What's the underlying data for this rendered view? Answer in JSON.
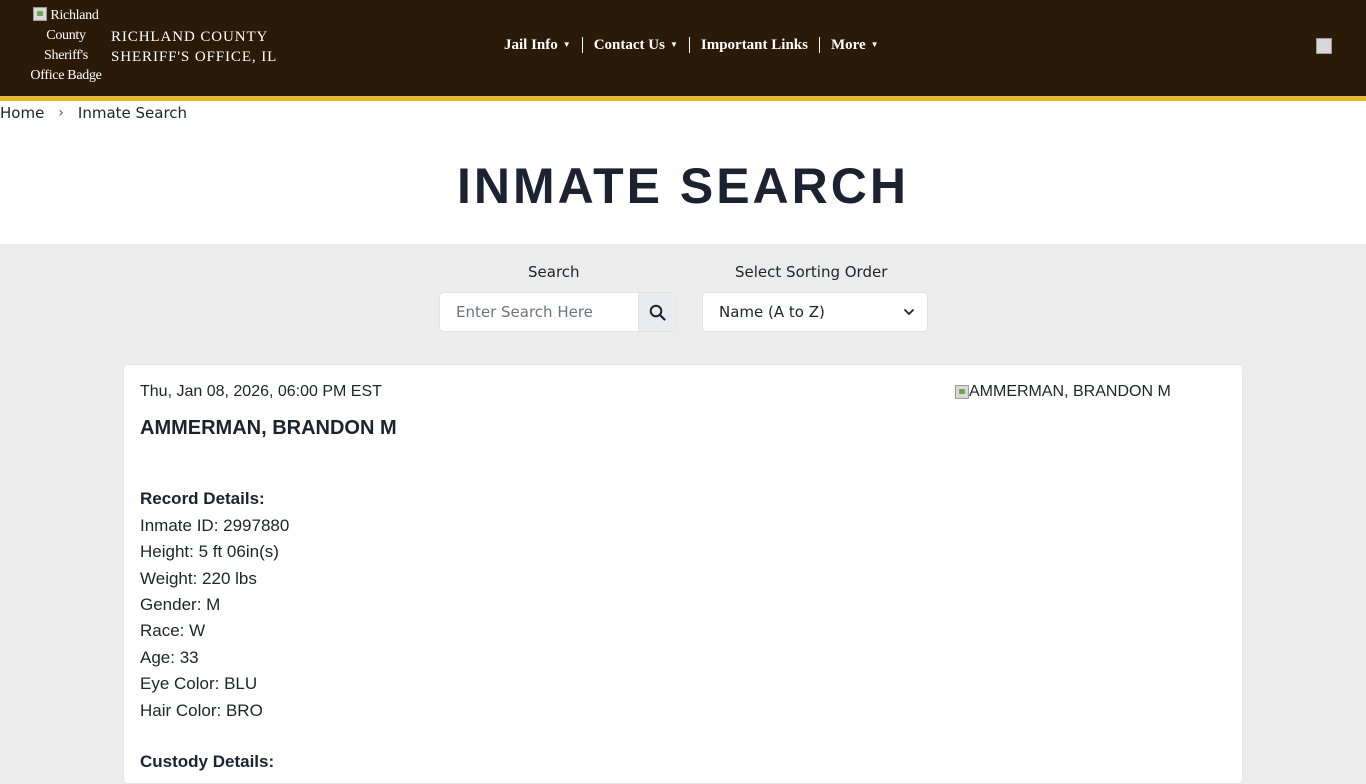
{
  "header": {
    "logo_alt": "Richland County Sheriff's Office Badge",
    "site_name_line1": "RICHLAND COUNTY",
    "site_name_line2": "SHERIFF'S OFFICE, IL",
    "nav": [
      {
        "label": "Jail Info",
        "has_dropdown": true
      },
      {
        "label": "Contact Us",
        "has_dropdown": true
      },
      {
        "label": "Important Links",
        "has_dropdown": false
      },
      {
        "label": "More",
        "has_dropdown": true
      }
    ]
  },
  "breadcrumb": {
    "home": "Home",
    "separator": "›",
    "current": "Inmate Search"
  },
  "page": {
    "title": "INMATE SEARCH"
  },
  "search": {
    "label": "Search",
    "placeholder": "Enter Search Here",
    "sort_label": "Select Sorting Order",
    "sort_value": "Name (A to Z)"
  },
  "inmate": {
    "date": "Thu, Jan 08, 2026, 06:00 PM EST",
    "name": "AMMERMAN, BRANDON M",
    "photo_alt": "AMMERMAN, BRANDON M",
    "record_heading": "Record Details:",
    "details": [
      "Inmate ID: 2997880",
      "Height: 5 ft 06in(s)",
      "Weight: 220 lbs",
      "Gender: M",
      "Race: W",
      "Age: 33",
      "Eye Color: BLU",
      "Hair Color: BRO"
    ],
    "custody_heading": "Custody Details:"
  },
  "colors": {
    "header_bg": "#2b1a08",
    "header_accent": "#e8b62a",
    "page_bg": "#ececec",
    "title": "#1b2230"
  }
}
